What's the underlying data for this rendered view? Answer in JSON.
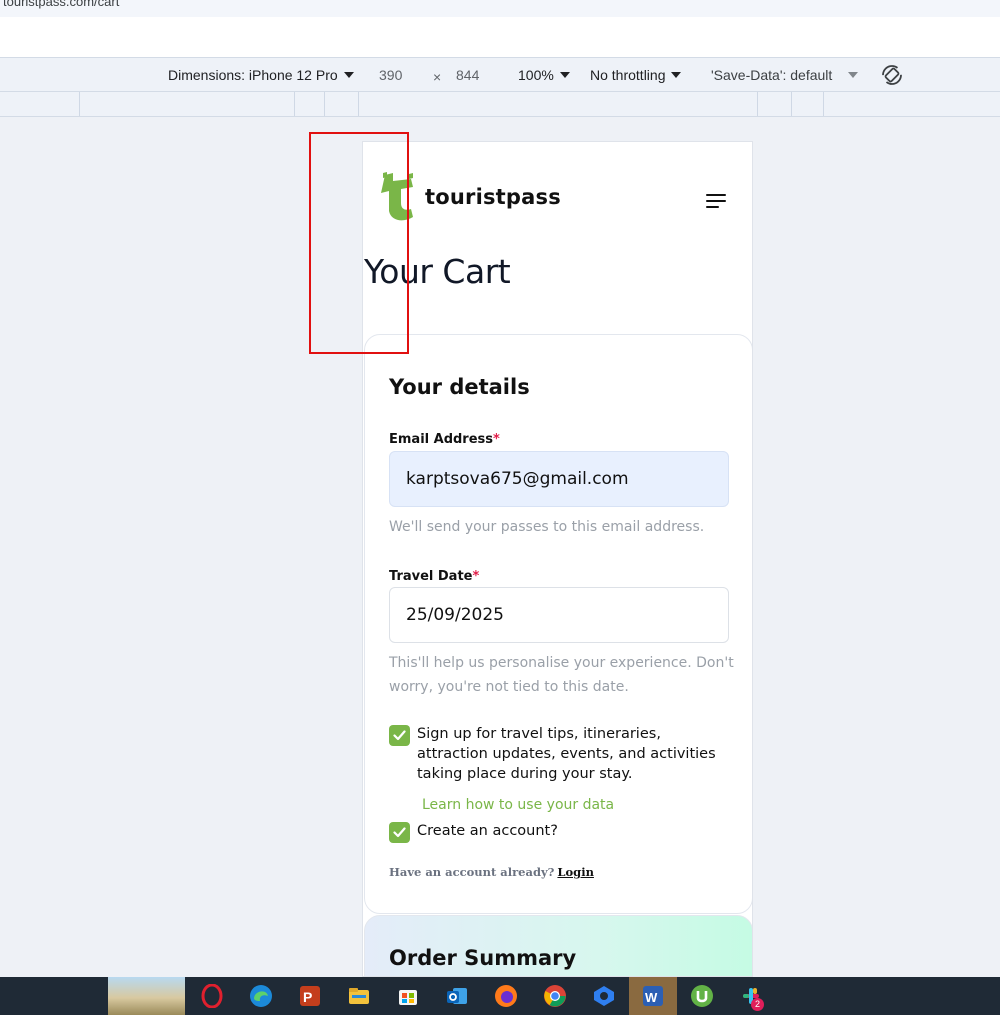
{
  "browser": {
    "url": "touristpass.com/cart"
  },
  "devtools": {
    "device": "Dimensions: iPhone 12 Pro",
    "width": "390",
    "times": "×",
    "height": "844",
    "zoom": "100%",
    "throttling": "No throttling",
    "save_data": "'Save-Data': default"
  },
  "site": {
    "logo_text": "touristpass",
    "page_title": "Your Cart"
  },
  "details": {
    "title": "Your details",
    "email_label": "Email Address",
    "email_required": "*",
    "email_value": "karptsova675@gmail.com",
    "email_hint": "We'll send your passes to this email address.",
    "date_label": "Travel Date",
    "date_required": "*",
    "date_value": "25/09/2025",
    "date_hint": "This'll help us personalise your experience. Don't worry, you're not tied to this date.",
    "newsletter_label": "Sign up for travel tips, itineraries, attraction updates, events, and activities taking place during your stay.",
    "newsletter_checked": true,
    "learn_link": "Learn how to use your data",
    "create_account_label": "Create an account?",
    "create_account_checked": true,
    "have_account_text": "Have an account already?",
    "login_link": "Login"
  },
  "summary": {
    "title": "Order Summary"
  },
  "colors": {
    "brand_green": "#7ab648",
    "required_red": "#e11d48",
    "annotation_red": "#e11010"
  },
  "taskbar": {
    "icons": [
      "opera-icon",
      "edge-icon",
      "powerpoint-icon",
      "file-explorer-icon",
      "microsoft-store-icon",
      "outlook-icon",
      "firefox-icon",
      "chrome-icon",
      "cloud-app-icon",
      "word-icon",
      "utorrent-icon",
      "slack-icon"
    ],
    "slack_badge": "2"
  }
}
